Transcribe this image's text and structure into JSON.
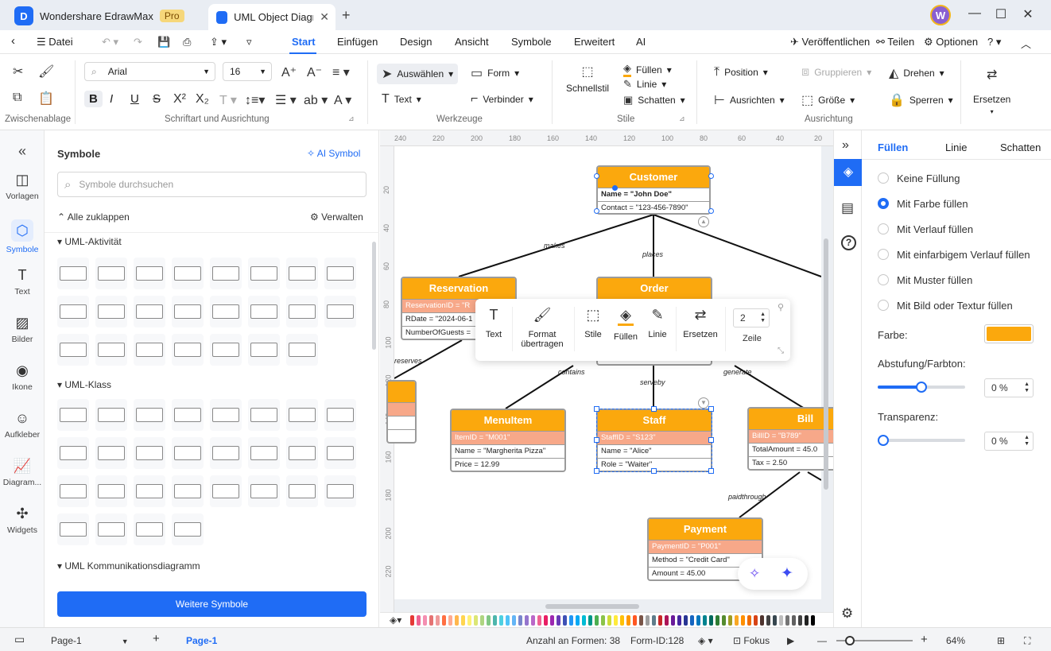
{
  "titlebar": {
    "app_name": "Wondershare EdrawMax",
    "pro_badge": "Pro",
    "doc_tab": "UML Object Diagr...",
    "avatar_initial": "W"
  },
  "menubar": {
    "file": "Datei",
    "tabs": [
      "Start",
      "Einfügen",
      "Design",
      "Ansicht",
      "Symbole",
      "Erweitert",
      "AI"
    ],
    "active_tab": "Start",
    "ai_badge": "hot",
    "publish": "Veröffentlichen",
    "share": "Teilen",
    "options": "Optionen"
  },
  "ribbon": {
    "font_family": "Arial",
    "font_size": "16",
    "select": "Auswählen",
    "shape": "Form",
    "text": "Text",
    "connector": "Verbinder",
    "quickstyle": "Schnellstil",
    "fill": "Füllen",
    "line": "Linie",
    "shadow": "Schatten",
    "position": "Position",
    "group": "Gruppieren",
    "rotate": "Drehen",
    "align": "Ausrichten",
    "size": "Größe",
    "lock": "Sperren",
    "replace": "Ersetzen",
    "groups": {
      "clipboard": "Zwischenablage",
      "font": "Schriftart und Ausrichtung",
      "tools": "Werkzeuge",
      "styles": "Stile",
      "arrange": "Ausrichtung"
    }
  },
  "leftrail": [
    "Vorlagen",
    "Symbole",
    "Text",
    "Bilder",
    "Ikone",
    "Aufkleber",
    "Diagram...",
    "Widgets"
  ],
  "symbols": {
    "title": "Symbole",
    "ai_symbol": "AI Symbol",
    "search_placeholder": "Symbole durchsuchen",
    "collapse_all": "Alle zuklappen",
    "manage": "Verwalten",
    "sections": [
      "UML-Aktivität",
      "UML-Klass",
      "UML Kommunikationsdiagramm"
    ],
    "more_button": "Weitere Symbole"
  },
  "ruler": {
    "top": [
      "240",
      "220",
      "200",
      "180",
      "160",
      "140",
      "120",
      "100",
      "80",
      "60",
      "40",
      "20"
    ],
    "left": [
      "20",
      "40",
      "60",
      "80",
      "100",
      "120",
      "140",
      "160",
      "180",
      "200",
      "220"
    ]
  },
  "diagram": {
    "objects": [
      {
        "name": "Customer",
        "attrs": [
          {
            "t": "Name = \"John Doe\"",
            "key": false,
            "bold": true
          },
          {
            "t": "Contact = \"123-456-7890\"",
            "key": false
          }
        ]
      },
      {
        "name": "Reservation",
        "attrs": [
          {
            "t": "ReservationID = \"R",
            "key": true
          },
          {
            "t": "RDate = \"2024-06-1",
            "key": false
          },
          {
            "t": "NumberOfGuests = ",
            "key": false
          }
        ]
      },
      {
        "name": "Order",
        "attrs": []
      },
      {
        "name": "MenuItem",
        "attrs": [
          {
            "t": "ItemID = \"M001\"",
            "key": true
          },
          {
            "t": "Name = \"Margherita Pizza\"",
            "key": false
          },
          {
            "t": "Price = 12.99",
            "key": false
          }
        ]
      },
      {
        "name": "Staff",
        "attrs": [
          {
            "t": "StaffID = \"S123\"",
            "key": true
          },
          {
            "t": "Name = \"Alice\"",
            "key": false
          },
          {
            "t": "Role = \"Waiter\"",
            "key": false
          }
        ]
      },
      {
        "name": "Bill",
        "attrs": [
          {
            "t": "BillID = \"B789\"",
            "key": true
          },
          {
            "t": "TotalAmount = 45.0",
            "key": false
          },
          {
            "t": "Tax = 2.50",
            "key": false
          }
        ]
      },
      {
        "name": "Payment",
        "attrs": [
          {
            "t": "PaymentID = \"P001\"",
            "key": true
          },
          {
            "t": "Method = \"Credit Card\"",
            "key": false
          },
          {
            "t": "Amount = 45.00",
            "key": false
          }
        ]
      }
    ],
    "edges": [
      "makes",
      "places",
      "reserves",
      "contains",
      "serveby",
      "generate",
      "paidthrough"
    ]
  },
  "floatbar": {
    "text": "Text",
    "format": "Format übertragen",
    "styles": "Stile",
    "fill": "Füllen",
    "line": "Linie",
    "replace": "Ersetzen",
    "rows_label": "Zeile",
    "rows_value": "2"
  },
  "rightpanel": {
    "tabs": [
      "Füllen",
      "Linie",
      "Schatten"
    ],
    "options": [
      "Keine Füllung",
      "Mit Farbe füllen",
      "Mit Verlauf füllen",
      "Mit einfarbigem Verlauf füllen",
      "Mit Muster füllen",
      "Mit Bild oder Textur füllen"
    ],
    "selected_option": "Mit Farbe füllen",
    "color_label": "Farbe:",
    "color_value": "#fba80d",
    "shade_label": "Abstufung/Farbton:",
    "shade_value": "0 %",
    "transparency_label": "Transparenz:",
    "transparency_value": "0 %"
  },
  "statusbar": {
    "page_select": "Page-1",
    "page_tab": "Page-1",
    "shape_count": "Anzahl an Formen: 38",
    "shape_id": "Form-ID:128",
    "focus": "Fokus",
    "zoom": "64%"
  },
  "palette_colors": [
    "#e53935",
    "#f06292",
    "#f48fb1",
    "#e57373",
    "#ef9a9a",
    "#ff7043",
    "#ffab91",
    "#ffb74d",
    "#ffd54f",
    "#fff176",
    "#dce775",
    "#aed581",
    "#81c784",
    "#4db6ac",
    "#4dd0e1",
    "#4fc3f7",
    "#64b5f6",
    "#7986cb",
    "#9575cd",
    "#ba68c8",
    "#f06292",
    "#e91e63",
    "#9c27b0",
    "#673ab7",
    "#3f51b5",
    "#2196f3",
    "#03a9f4",
    "#00bcd4",
    "#009688",
    "#4caf50",
    "#8bc34a",
    "#cddc39",
    "#ffeb3b",
    "#ffc107",
    "#ff9800",
    "#ff5722",
    "#795548",
    "#9e9e9e",
    "#607d8b",
    "#c62828",
    "#ad1457",
    "#6a1b9a",
    "#4527a0",
    "#283593",
    "#1565c0",
    "#0277bd",
    "#00838f",
    "#00695c",
    "#2e7d32",
    "#558b2f",
    "#9e9d24",
    "#f9a825",
    "#ff8f00",
    "#ef6c00",
    "#d84315",
    "#4e342e",
    "#424242",
    "#37474f",
    "#bdbdbd",
    "#757575",
    "#616161",
    "#424242",
    "#212121",
    "#000000"
  ]
}
